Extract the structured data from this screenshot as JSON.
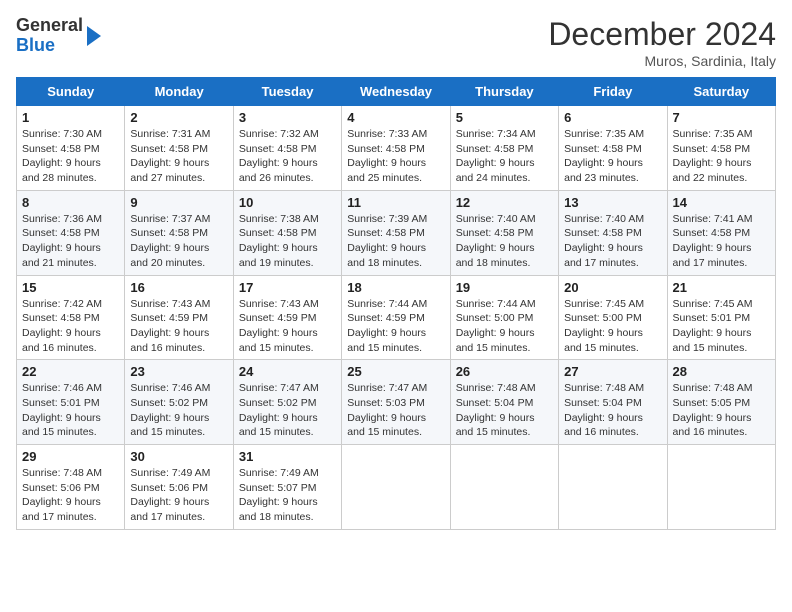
{
  "header": {
    "logo_line1": "General",
    "logo_line2": "Blue",
    "month": "December 2024",
    "location": "Muros, Sardinia, Italy"
  },
  "weekdays": [
    "Sunday",
    "Monday",
    "Tuesday",
    "Wednesday",
    "Thursday",
    "Friday",
    "Saturday"
  ],
  "weeks": [
    [
      {
        "day": "1",
        "sunrise": "7:30 AM",
        "sunset": "4:58 PM",
        "daylight": "9 hours and 28 minutes."
      },
      {
        "day": "2",
        "sunrise": "7:31 AM",
        "sunset": "4:58 PM",
        "daylight": "9 hours and 27 minutes."
      },
      {
        "day": "3",
        "sunrise": "7:32 AM",
        "sunset": "4:58 PM",
        "daylight": "9 hours and 26 minutes."
      },
      {
        "day": "4",
        "sunrise": "7:33 AM",
        "sunset": "4:58 PM",
        "daylight": "9 hours and 25 minutes."
      },
      {
        "day": "5",
        "sunrise": "7:34 AM",
        "sunset": "4:58 PM",
        "daylight": "9 hours and 24 minutes."
      },
      {
        "day": "6",
        "sunrise": "7:35 AM",
        "sunset": "4:58 PM",
        "daylight": "9 hours and 23 minutes."
      },
      {
        "day": "7",
        "sunrise": "7:35 AM",
        "sunset": "4:58 PM",
        "daylight": "9 hours and 22 minutes."
      }
    ],
    [
      {
        "day": "8",
        "sunrise": "7:36 AM",
        "sunset": "4:58 PM",
        "daylight": "9 hours and 21 minutes."
      },
      {
        "day": "9",
        "sunrise": "7:37 AM",
        "sunset": "4:58 PM",
        "daylight": "9 hours and 20 minutes."
      },
      {
        "day": "10",
        "sunrise": "7:38 AM",
        "sunset": "4:58 PM",
        "daylight": "9 hours and 19 minutes."
      },
      {
        "day": "11",
        "sunrise": "7:39 AM",
        "sunset": "4:58 PM",
        "daylight": "9 hours and 18 minutes."
      },
      {
        "day": "12",
        "sunrise": "7:40 AM",
        "sunset": "4:58 PM",
        "daylight": "9 hours and 18 minutes."
      },
      {
        "day": "13",
        "sunrise": "7:40 AM",
        "sunset": "4:58 PM",
        "daylight": "9 hours and 17 minutes."
      },
      {
        "day": "14",
        "sunrise": "7:41 AM",
        "sunset": "4:58 PM",
        "daylight": "9 hours and 17 minutes."
      }
    ],
    [
      {
        "day": "15",
        "sunrise": "7:42 AM",
        "sunset": "4:58 PM",
        "daylight": "9 hours and 16 minutes."
      },
      {
        "day": "16",
        "sunrise": "7:43 AM",
        "sunset": "4:59 PM",
        "daylight": "9 hours and 16 minutes."
      },
      {
        "day": "17",
        "sunrise": "7:43 AM",
        "sunset": "4:59 PM",
        "daylight": "9 hours and 15 minutes."
      },
      {
        "day": "18",
        "sunrise": "7:44 AM",
        "sunset": "4:59 PM",
        "daylight": "9 hours and 15 minutes."
      },
      {
        "day": "19",
        "sunrise": "7:44 AM",
        "sunset": "5:00 PM",
        "daylight": "9 hours and 15 minutes."
      },
      {
        "day": "20",
        "sunrise": "7:45 AM",
        "sunset": "5:00 PM",
        "daylight": "9 hours and 15 minutes."
      },
      {
        "day": "21",
        "sunrise": "7:45 AM",
        "sunset": "5:01 PM",
        "daylight": "9 hours and 15 minutes."
      }
    ],
    [
      {
        "day": "22",
        "sunrise": "7:46 AM",
        "sunset": "5:01 PM",
        "daylight": "9 hours and 15 minutes."
      },
      {
        "day": "23",
        "sunrise": "7:46 AM",
        "sunset": "5:02 PM",
        "daylight": "9 hours and 15 minutes."
      },
      {
        "day": "24",
        "sunrise": "7:47 AM",
        "sunset": "5:02 PM",
        "daylight": "9 hours and 15 minutes."
      },
      {
        "day": "25",
        "sunrise": "7:47 AM",
        "sunset": "5:03 PM",
        "daylight": "9 hours and 15 minutes."
      },
      {
        "day": "26",
        "sunrise": "7:48 AM",
        "sunset": "5:04 PM",
        "daylight": "9 hours and 15 minutes."
      },
      {
        "day": "27",
        "sunrise": "7:48 AM",
        "sunset": "5:04 PM",
        "daylight": "9 hours and 16 minutes."
      },
      {
        "day": "28",
        "sunrise": "7:48 AM",
        "sunset": "5:05 PM",
        "daylight": "9 hours and 16 minutes."
      }
    ],
    [
      {
        "day": "29",
        "sunrise": "7:48 AM",
        "sunset": "5:06 PM",
        "daylight": "9 hours and 17 minutes."
      },
      {
        "day": "30",
        "sunrise": "7:49 AM",
        "sunset": "5:06 PM",
        "daylight": "9 hours and 17 minutes."
      },
      {
        "day": "31",
        "sunrise": "7:49 AM",
        "sunset": "5:07 PM",
        "daylight": "9 hours and 18 minutes."
      },
      null,
      null,
      null,
      null
    ]
  ]
}
